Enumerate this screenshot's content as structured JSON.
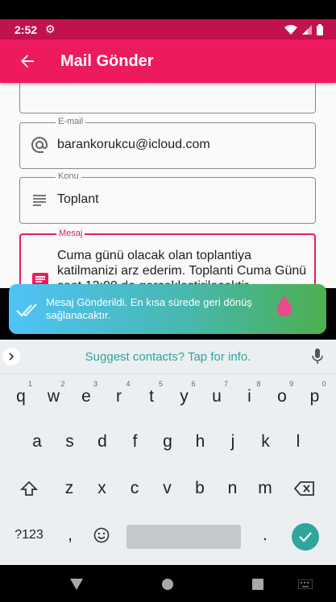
{
  "status_bar": {
    "time": "2:52"
  },
  "app_bar": {
    "title": "Mail Gönder"
  },
  "form": {
    "email": {
      "label": "E-mail",
      "value": "barankorukcu@icloud.com"
    },
    "konu": {
      "label": "Konu",
      "value": "Toplant"
    },
    "mesaj": {
      "label": "Mesaj",
      "value": "Cuma günü olacak olan toplantiya katilmanizi arz ederim. Toplanti Cuma Günü saat 13:00 da gerçekleştirilecektir."
    }
  },
  "toast": {
    "message": "Mesaj Gönderildi. En kısa sürede geri dönüş sağlanacaktır."
  },
  "keyboard": {
    "suggestion": "Suggest contacts? Tap for info.",
    "row1": [
      {
        "k": "q",
        "h": "1"
      },
      {
        "k": "w",
        "h": "2"
      },
      {
        "k": "e",
        "h": "3"
      },
      {
        "k": "r",
        "h": "4"
      },
      {
        "k": "t",
        "h": "5"
      },
      {
        "k": "y",
        "h": "6"
      },
      {
        "k": "u",
        "h": "7"
      },
      {
        "k": "i",
        "h": "8"
      },
      {
        "k": "o",
        "h": "9"
      },
      {
        "k": "p",
        "h": "0"
      }
    ],
    "row2": [
      "a",
      "s",
      "d",
      "f",
      "g",
      "h",
      "j",
      "k",
      "l"
    ],
    "row3": [
      "z",
      "x",
      "c",
      "v",
      "b",
      "n",
      "m"
    ],
    "symbols": "?123",
    "comma": ",",
    "period": "."
  },
  "colors": {
    "primary": "#ee1a5e",
    "status": "#c2124e",
    "accent": "#30a59c"
  }
}
